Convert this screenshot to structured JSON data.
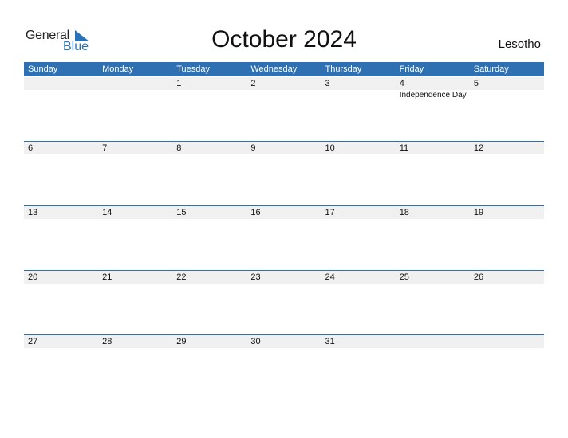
{
  "logo": {
    "part1": "General",
    "part2": "Blue",
    "accent": "#2a73b8"
  },
  "title": "October 2024",
  "country": "Lesotho",
  "weekdays": [
    "Sunday",
    "Monday",
    "Tuesday",
    "Wednesday",
    "Thursday",
    "Friday",
    "Saturday"
  ],
  "weeks": [
    [
      {
        "day": ""
      },
      {
        "day": ""
      },
      {
        "day": "1"
      },
      {
        "day": "2"
      },
      {
        "day": "3"
      },
      {
        "day": "4",
        "event": "Independence Day"
      },
      {
        "day": "5"
      }
    ],
    [
      {
        "day": "6"
      },
      {
        "day": "7"
      },
      {
        "day": "8"
      },
      {
        "day": "9"
      },
      {
        "day": "10"
      },
      {
        "day": "11"
      },
      {
        "day": "12"
      }
    ],
    [
      {
        "day": "13"
      },
      {
        "day": "14"
      },
      {
        "day": "15"
      },
      {
        "day": "16"
      },
      {
        "day": "17"
      },
      {
        "day": "18"
      },
      {
        "day": "19"
      }
    ],
    [
      {
        "day": "20"
      },
      {
        "day": "21"
      },
      {
        "day": "22"
      },
      {
        "day": "23"
      },
      {
        "day": "24"
      },
      {
        "day": "25"
      },
      {
        "day": "26"
      }
    ],
    [
      {
        "day": "27"
      },
      {
        "day": "28"
      },
      {
        "day": "29"
      },
      {
        "day": "30"
      },
      {
        "day": "31"
      },
      {
        "day": ""
      },
      {
        "day": ""
      }
    ]
  ],
  "colors": {
    "header": "#2e70b2",
    "band": "#f0f0f0"
  }
}
